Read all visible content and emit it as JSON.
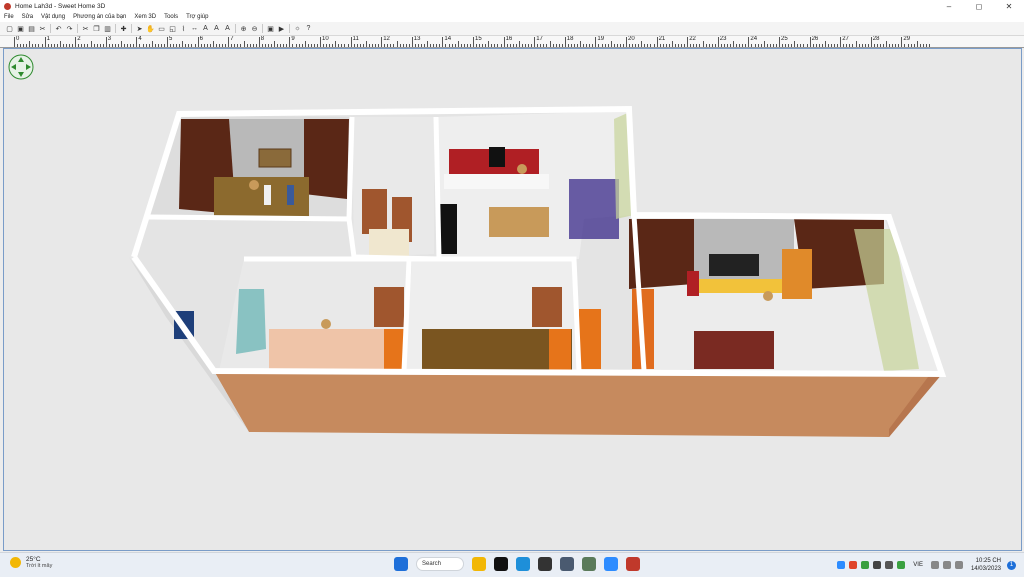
{
  "window": {
    "title": "Home Lah3d - Sweet Home 3D",
    "minimize": "–",
    "maximize": "◻",
    "close": "✕"
  },
  "menu": [
    "File",
    "Sửa",
    "Vật dụng",
    "Phương án của bạn",
    "Xem 3D",
    "Tools",
    "Trợ giúp"
  ],
  "toolbar_icons": [
    "new-icon",
    "open-icon",
    "save-icon",
    "cut-icon",
    "undo-icon",
    "redo-icon",
    "cut2-icon",
    "copy-icon",
    "paste-icon",
    "add-furniture-icon",
    "select-icon",
    "pan-icon",
    "create-walls-icon",
    "create-rooms-icon",
    "create-polylines-icon",
    "create-dimensions-icon",
    "add-text-icon",
    "increase-text-icon",
    "decrease-text-icon",
    "zoom-in-icon",
    "zoom-out-icon",
    "create-photo-icon",
    "create-video-icon",
    "preferences-icon",
    "help-icon"
  ],
  "ruler": {
    "labels": [
      "0",
      "1",
      "2",
      "3",
      "4",
      "5",
      "6",
      "7",
      "8",
      "9",
      "10",
      "11",
      "12",
      "13",
      "14",
      "15",
      "16",
      "17",
      "18",
      "19",
      "20",
      "21",
      "22",
      "23",
      "24",
      "25",
      "26",
      "27",
      "28",
      "29"
    ]
  },
  "view": {
    "wall_color": "#f4f4f4",
    "floor_color": "#e6e6e6",
    "outer_wall_color": "#c8875a",
    "wood_color": "#6b2a18"
  },
  "taskbar": {
    "weather_temp": "25°C",
    "weather_desc": "Trời ít mây",
    "search_label": "Search",
    "lang": "VIE",
    "time": "10:25 CH",
    "date": "14/03/2023",
    "notification_count": "1"
  }
}
